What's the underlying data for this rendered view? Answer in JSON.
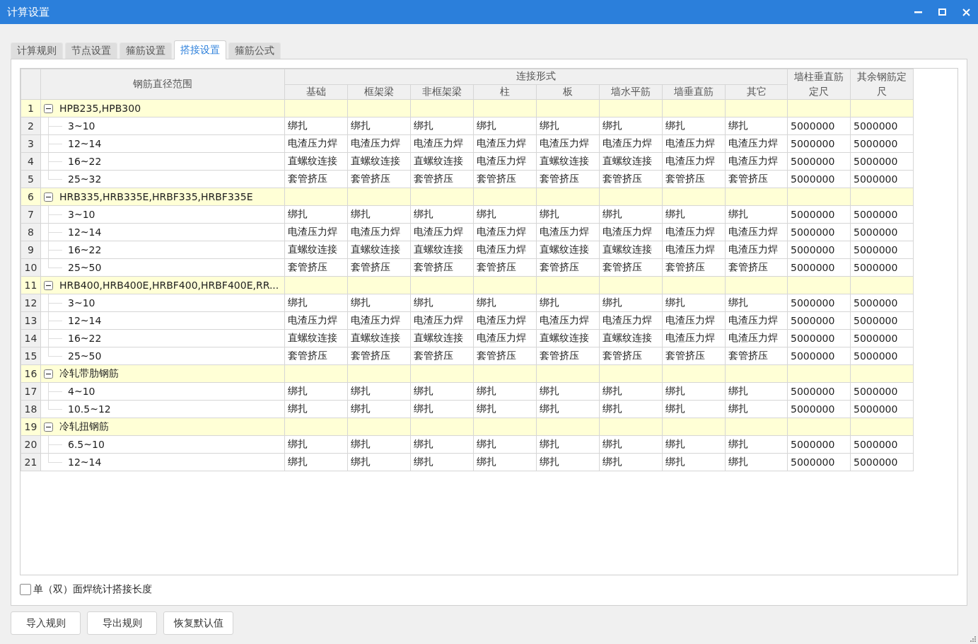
{
  "window": {
    "title": "计算设置"
  },
  "tabs": [
    {
      "label": "计算规则",
      "selected": false
    },
    {
      "label": "节点设置",
      "selected": false
    },
    {
      "label": "箍筋设置",
      "selected": false
    },
    {
      "label": "搭接设置",
      "selected": true
    },
    {
      "label": "箍筋公式",
      "selected": false
    }
  ],
  "table": {
    "range_header": "钢筋直径范围",
    "group_header": "连接形式",
    "columns": [
      "基础",
      "框架梁",
      "非框架梁",
      "柱",
      "板",
      "墙水平筋",
      "墙垂直筋",
      "其它"
    ],
    "extra_columns": [
      "墙柱垂直筋定尺",
      "其余钢筋定尺"
    ],
    "groups": [
      {
        "number": "1",
        "label": "HPB235,HPB300",
        "expanded": true,
        "children": [
          {
            "number": "2",
            "label": "3~10",
            "cells": [
              "绑扎",
              "绑扎",
              "绑扎",
              "绑扎",
              "绑扎",
              "绑扎",
              "绑扎",
              "绑扎",
              "5000000",
              "5000000"
            ]
          },
          {
            "number": "3",
            "label": "12~14",
            "cells": [
              "电渣压力焊",
              "电渣压力焊",
              "电渣压力焊",
              "电渣压力焊",
              "电渣压力焊",
              "电渣压力焊",
              "电渣压力焊",
              "电渣压力焊",
              "5000000",
              "5000000"
            ]
          },
          {
            "number": "4",
            "label": "16~22",
            "cells": [
              "直螺纹连接",
              "直螺纹连接",
              "直螺纹连接",
              "电渣压力焊",
              "直螺纹连接",
              "直螺纹连接",
              "电渣压力焊",
              "电渣压力焊",
              "5000000",
              "5000000"
            ]
          },
          {
            "number": "5",
            "label": "25~32",
            "cells": [
              "套管挤压",
              "套管挤压",
              "套管挤压",
              "套管挤压",
              "套管挤压",
              "套管挤压",
              "套管挤压",
              "套管挤压",
              "5000000",
              "5000000"
            ]
          }
        ]
      },
      {
        "number": "6",
        "label": "HRB335,HRB335E,HRBF335,HRBF335E",
        "expanded": true,
        "children": [
          {
            "number": "7",
            "label": "3~10",
            "cells": [
              "绑扎",
              "绑扎",
              "绑扎",
              "绑扎",
              "绑扎",
              "绑扎",
              "绑扎",
              "绑扎",
              "5000000",
              "5000000"
            ]
          },
          {
            "number": "8",
            "label": "12~14",
            "cells": [
              "电渣压力焊",
              "电渣压力焊",
              "电渣压力焊",
              "电渣压力焊",
              "电渣压力焊",
              "电渣压力焊",
              "电渣压力焊",
              "电渣压力焊",
              "5000000",
              "5000000"
            ]
          },
          {
            "number": "9",
            "label": "16~22",
            "cells": [
              "直螺纹连接",
              "直螺纹连接",
              "直螺纹连接",
              "电渣压力焊",
              "直螺纹连接",
              "直螺纹连接",
              "电渣压力焊",
              "电渣压力焊",
              "5000000",
              "5000000"
            ]
          },
          {
            "number": "10",
            "label": "25~50",
            "cells": [
              "套管挤压",
              "套管挤压",
              "套管挤压",
              "套管挤压",
              "套管挤压",
              "套管挤压",
              "套管挤压",
              "套管挤压",
              "5000000",
              "5000000"
            ]
          }
        ]
      },
      {
        "number": "11",
        "label": "HRB400,HRB400E,HRBF400,HRBF400E,RR...",
        "expanded": true,
        "children": [
          {
            "number": "12",
            "label": "3~10",
            "cells": [
              "绑扎",
              "绑扎",
              "绑扎",
              "绑扎",
              "绑扎",
              "绑扎",
              "绑扎",
              "绑扎",
              "5000000",
              "5000000"
            ]
          },
          {
            "number": "13",
            "label": "12~14",
            "cells": [
              "电渣压力焊",
              "电渣压力焊",
              "电渣压力焊",
              "电渣压力焊",
              "电渣压力焊",
              "电渣压力焊",
              "电渣压力焊",
              "电渣压力焊",
              "5000000",
              "5000000"
            ]
          },
          {
            "number": "14",
            "label": "16~22",
            "cells": [
              "直螺纹连接",
              "直螺纹连接",
              "直螺纹连接",
              "电渣压力焊",
              "直螺纹连接",
              "直螺纹连接",
              "电渣压力焊",
              "电渣压力焊",
              "5000000",
              "5000000"
            ]
          },
          {
            "number": "15",
            "label": "25~50",
            "cells": [
              "套管挤压",
              "套管挤压",
              "套管挤压",
              "套管挤压",
              "套管挤压",
              "套管挤压",
              "套管挤压",
              "套管挤压",
              "5000000",
              "5000000"
            ]
          }
        ]
      },
      {
        "number": "16",
        "label": "冷轧带肋钢筋",
        "expanded": true,
        "children": [
          {
            "number": "17",
            "label": "4~10",
            "cells": [
              "绑扎",
              "绑扎",
              "绑扎",
              "绑扎",
              "绑扎",
              "绑扎",
              "绑扎",
              "绑扎",
              "5000000",
              "5000000"
            ]
          },
          {
            "number": "18",
            "label": "10.5~12",
            "cells": [
              "绑扎",
              "绑扎",
              "绑扎",
              "绑扎",
              "绑扎",
              "绑扎",
              "绑扎",
              "绑扎",
              "5000000",
              "5000000"
            ]
          }
        ]
      },
      {
        "number": "19",
        "label": "冷轧扭钢筋",
        "expanded": true,
        "children": [
          {
            "number": "20",
            "label": "6.5~10",
            "cells": [
              "绑扎",
              "绑扎",
              "绑扎",
              "绑扎",
              "绑扎",
              "绑扎",
              "绑扎",
              "绑扎",
              "5000000",
              "5000000"
            ]
          },
          {
            "number": "21",
            "label": "12~14",
            "cells": [
              "绑扎",
              "绑扎",
              "绑扎",
              "绑扎",
              "绑扎",
              "绑扎",
              "绑扎",
              "绑扎",
              "5000000",
              "5000000"
            ]
          }
        ]
      }
    ]
  },
  "option": {
    "label": "单（双）面焊统计搭接长度",
    "checked": false
  },
  "buttons": [
    "导入规则",
    "导出规则",
    "恢复默认值"
  ]
}
